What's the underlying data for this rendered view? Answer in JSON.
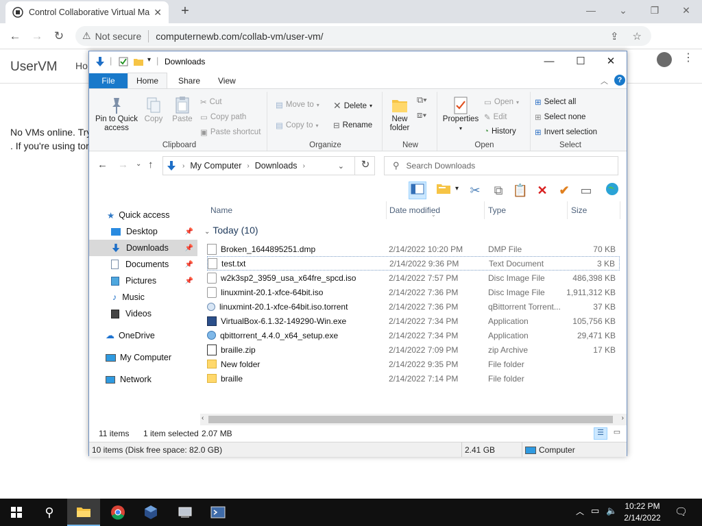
{
  "browser": {
    "tab_title": "Control Collaborative Virtual Ma",
    "tab_close": "✕",
    "new_tab": "+",
    "security_label": "Not secure",
    "url": "computernewb.com/collab-vm/user-vm/",
    "window_controls": {
      "minimize": "—",
      "maximize": "❐",
      "close": "✕"
    }
  },
  "page": {
    "brand": "UserVM",
    "nav_partial": "Ho",
    "message_line1": "No VMs online. Try",
    "message_line2": ". If you're using tor"
  },
  "explorer": {
    "title": "Downloads",
    "ribbon_tabs": {
      "file": "File",
      "home": "Home",
      "share": "Share",
      "view": "View"
    },
    "groups": {
      "clipboard": {
        "label": "Clipboard",
        "pin": "Pin to Quick access",
        "copy": "Copy",
        "paste": "Paste",
        "cut": "Cut",
        "copy_path": "Copy path",
        "paste_shortcut": "Paste shortcut"
      },
      "organize": {
        "label": "Organize",
        "move_to": "Move to",
        "copy_to": "Copy to",
        "delete": "Delete",
        "rename": "Rename"
      },
      "new": {
        "label": "New",
        "new_folder": "New folder"
      },
      "open": {
        "label": "Open",
        "properties": "Properties",
        "open": "Open",
        "edit": "Edit",
        "history": "History"
      },
      "select": {
        "label": "Select",
        "select_all": "Select all",
        "select_none": "Select none",
        "invert": "Invert selection"
      }
    },
    "breadcrumb": [
      "My Computer",
      "Downloads"
    ],
    "search_placeholder": "Search Downloads",
    "nav_pane": [
      {
        "label": "Quick access",
        "icon": "star-icon"
      },
      {
        "label": "Desktop",
        "icon": "desktop-icon",
        "pinned": true
      },
      {
        "label": "Downloads",
        "icon": "download-icon",
        "pinned": true
      },
      {
        "label": "Documents",
        "icon": "documents-icon",
        "pinned": true
      },
      {
        "label": "Pictures",
        "icon": "pictures-icon",
        "pinned": true
      },
      {
        "label": "Music",
        "icon": "music-icon"
      },
      {
        "label": "Videos",
        "icon": "videos-icon"
      },
      {
        "label": "OneDrive",
        "icon": "cloud-icon"
      },
      {
        "label": "My Computer",
        "icon": "computer-icon"
      },
      {
        "label": "Network",
        "icon": "network-icon"
      }
    ],
    "columns": {
      "name": "Name",
      "date": "Date modified",
      "type": "Type",
      "size": "Size"
    },
    "group_header": "Today (10)",
    "files": [
      {
        "name": "Broken_1644895251.dmp",
        "date": "2/14/2022 10:20 PM",
        "type": "DMP File",
        "size": "70 KB",
        "icon": "file-icon"
      },
      {
        "name": "test.txt",
        "date": "2/14/2022 9:36 PM",
        "type": "Text Document",
        "size": "3 KB",
        "icon": "text-file-icon"
      },
      {
        "name": "w2k3sp2_3959_usa_x64fre_spcd.iso",
        "date": "2/14/2022 7:57 PM",
        "type": "Disc Image File",
        "size": "486,398 KB",
        "icon": "disc-icon"
      },
      {
        "name": "linuxmint-20.1-xfce-64bit.iso",
        "date": "2/14/2022 7:36 PM",
        "type": "Disc Image File",
        "size": "1,911,312 KB",
        "icon": "disc-icon"
      },
      {
        "name": "linuxmint-20.1-xfce-64bit.iso.torrent",
        "date": "2/14/2022 7:36 PM",
        "type": "qBittorrent Torrent...",
        "size": "37 KB",
        "icon": "torrent-icon"
      },
      {
        "name": "VirtualBox-6.1.32-149290-Win.exe",
        "date": "2/14/2022 7:34 PM",
        "type": "Application",
        "size": "105,756 KB",
        "icon": "virtualbox-icon"
      },
      {
        "name": "qbittorrent_4.4.0_x64_setup.exe",
        "date": "2/14/2022 7:34 PM",
        "type": "Application",
        "size": "29,471 KB",
        "icon": "qbittorrent-icon"
      },
      {
        "name": "braille.zip",
        "date": "2/14/2022 7:09 PM",
        "type": "zip Archive",
        "size": "17 KB",
        "icon": "zip-icon"
      },
      {
        "name": "New folder",
        "date": "2/14/2022 9:35 PM",
        "type": "File folder",
        "size": "",
        "icon": "folder-icon"
      },
      {
        "name": "braille",
        "date": "2/14/2022 7:14 PM",
        "type": "File folder",
        "size": "",
        "icon": "folder-icon"
      }
    ],
    "status": {
      "items": "11 items",
      "selected": "1 item selected",
      "selected_size": "2.07 MB"
    },
    "status2": {
      "summary": "10 items (Disk free space: 82.0 GB)",
      "size": "2.41 GB",
      "location": "Computer"
    }
  },
  "taskbar": {
    "time": "10:22 PM",
    "date": "2/14/2022"
  },
  "colors": {
    "accent": "#1979ca",
    "selection": "#cce8ff",
    "taskbar": "#101010"
  }
}
